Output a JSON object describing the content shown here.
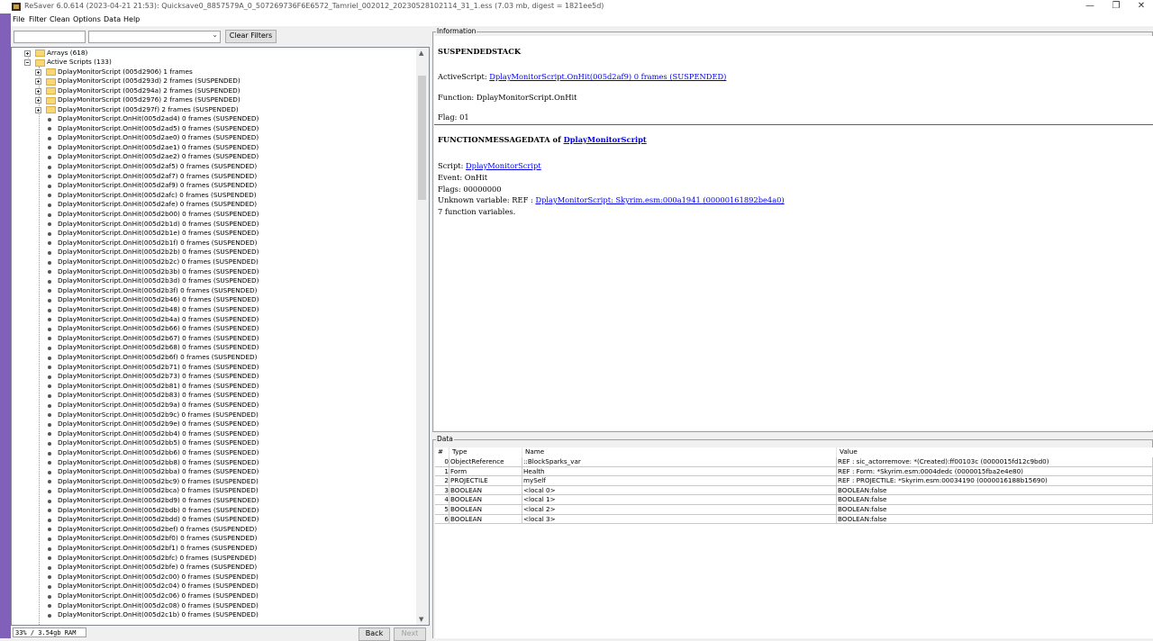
{
  "window": {
    "title": "ReSaver 6.0.614 (2023-04-21 21:53): Quicksave0_8857579A_0_507269736F6E6572_Tamriel_002012_20230528102114_31_1.ess (7.03 mb, digest = 1821ee5d)",
    "minimize_glyph": "—",
    "maximize_glyph": "❐",
    "close_glyph": "✕"
  },
  "menu": [
    "File",
    "Filter",
    "Clean",
    "Options",
    "Data",
    "Help"
  ],
  "filter": {
    "text_value": "",
    "combo_value": "",
    "clear_label": "Clear Filters"
  },
  "tree": {
    "arrays_label": "Arrays (618)",
    "active_scripts_label": "Active Scripts (133)",
    "folders": [
      "DplayMonitorScript (005d2906) 1 frames",
      "DplayMonitorScript (005d293d) 2 frames (SUSPENDED)",
      "DplayMonitorScript (005d294a) 2 frames (SUSPENDED)",
      "DplayMonitorScript (005d2976) 2 frames (SUSPENDED)",
      "DplayMonitorScript (005d297f) 2 frames (SUSPENDED)"
    ],
    "entries": [
      "DplayMonitorScript.OnHit(005d2ad4) 0 frames (SUSPENDED)",
      "DplayMonitorScript.OnHit(005d2ad5) 0 frames (SUSPENDED)",
      "DplayMonitorScript.OnHit(005d2ae0) 0 frames (SUSPENDED)",
      "DplayMonitorScript.OnHit(005d2ae1) 0 frames (SUSPENDED)",
      "DplayMonitorScript.OnHit(005d2ae2) 0 frames (SUSPENDED)",
      "DplayMonitorScript.OnHit(005d2af5) 0 frames (SUSPENDED)",
      "DplayMonitorScript.OnHit(005d2af7) 0 frames (SUSPENDED)",
      "DplayMonitorScript.OnHit(005d2af9) 0 frames (SUSPENDED)",
      "DplayMonitorScript.OnHit(005d2afc) 0 frames (SUSPENDED)",
      "DplayMonitorScript.OnHit(005d2afe) 0 frames (SUSPENDED)",
      "DplayMonitorScript.OnHit(005d2b00) 0 frames (SUSPENDED)",
      "DplayMonitorScript.OnHit(005d2b1d) 0 frames (SUSPENDED)",
      "DplayMonitorScript.OnHit(005d2b1e) 0 frames (SUSPENDED)",
      "DplayMonitorScript.OnHit(005d2b1f) 0 frames (SUSPENDED)",
      "DplayMonitorScript.OnHit(005d2b2b) 0 frames (SUSPENDED)",
      "DplayMonitorScript.OnHit(005d2b2c) 0 frames (SUSPENDED)",
      "DplayMonitorScript.OnHit(005d2b3b) 0 frames (SUSPENDED)",
      "DplayMonitorScript.OnHit(005d2b3d) 0 frames (SUSPENDED)",
      "DplayMonitorScript.OnHit(005d2b3f) 0 frames (SUSPENDED)",
      "DplayMonitorScript.OnHit(005d2b46) 0 frames (SUSPENDED)",
      "DplayMonitorScript.OnHit(005d2b48) 0 frames (SUSPENDED)",
      "DplayMonitorScript.OnHit(005d2b4a) 0 frames (SUSPENDED)",
      "DplayMonitorScript.OnHit(005d2b66) 0 frames (SUSPENDED)",
      "DplayMonitorScript.OnHit(005d2b67) 0 frames (SUSPENDED)",
      "DplayMonitorScript.OnHit(005d2b68) 0 frames (SUSPENDED)",
      "DplayMonitorScript.OnHit(005d2b6f) 0 frames (SUSPENDED)",
      "DplayMonitorScript.OnHit(005d2b71) 0 frames (SUSPENDED)",
      "DplayMonitorScript.OnHit(005d2b73) 0 frames (SUSPENDED)",
      "DplayMonitorScript.OnHit(005d2b81) 0 frames (SUSPENDED)",
      "DplayMonitorScript.OnHit(005d2b83) 0 frames (SUSPENDED)",
      "DplayMonitorScript.OnHit(005d2b9a) 0 frames (SUSPENDED)",
      "DplayMonitorScript.OnHit(005d2b9c) 0 frames (SUSPENDED)",
      "DplayMonitorScript.OnHit(005d2b9e) 0 frames (SUSPENDED)",
      "DplayMonitorScript.OnHit(005d2bb4) 0 frames (SUSPENDED)",
      "DplayMonitorScript.OnHit(005d2bb5) 0 frames (SUSPENDED)",
      "DplayMonitorScript.OnHit(005d2bb6) 0 frames (SUSPENDED)",
      "DplayMonitorScript.OnHit(005d2bb8) 0 frames (SUSPENDED)",
      "DplayMonitorScript.OnHit(005d2bba) 0 frames (SUSPENDED)",
      "DplayMonitorScript.OnHit(005d2bc9) 0 frames (SUSPENDED)",
      "DplayMonitorScript.OnHit(005d2bca) 0 frames (SUSPENDED)",
      "DplayMonitorScript.OnHit(005d2bd9) 0 frames (SUSPENDED)",
      "DplayMonitorScript.OnHit(005d2bdb) 0 frames (SUSPENDED)",
      "DplayMonitorScript.OnHit(005d2bdd) 0 frames (SUSPENDED)",
      "DplayMonitorScript.OnHit(005d2bef) 0 frames (SUSPENDED)",
      "DplayMonitorScript.OnHit(005d2bf0) 0 frames (SUSPENDED)",
      "DplayMonitorScript.OnHit(005d2bf1) 0 frames (SUSPENDED)",
      "DplayMonitorScript.OnHit(005d2bfc) 0 frames (SUSPENDED)",
      "DplayMonitorScript.OnHit(005d2bfe) 0 frames (SUSPENDED)",
      "DplayMonitorScript.OnHit(005d2c00) 0 frames (SUSPENDED)",
      "DplayMonitorScript.OnHit(005d2c04) 0 frames (SUSPENDED)",
      "DplayMonitorScript.OnHit(005d2c06) 0 frames (SUSPENDED)",
      "DplayMonitorScript.OnHit(005d2c08) 0 frames (SUSPENDED)",
      "DplayMonitorScript.OnHit(005d2c1b) 0 frames (SUSPENDED)"
    ]
  },
  "status": {
    "memory": "33% / 3.54gb RAM",
    "back_label": "Back",
    "next_label": "Next"
  },
  "info": {
    "group_label": "Information",
    "heading": "SUSPENDEDSTACK",
    "active_script_prefix": "ActiveScript: ",
    "active_script_link": "DplayMonitorScript.OnHit(005d2af9) 0 frames (SUSPENDED)",
    "function_line": "Function: DplayMonitorScript.OnHit",
    "flag_line": "Flag: 01",
    "fmd_heading": "FUNCTIONMESSAGEDATA of ",
    "fmd_link": "DplayMonitorScript",
    "script_prefix": "Script: ",
    "script_link": "DplayMonitorScript",
    "event_line": "Event: OnHit",
    "flags_line": "Flags: 00000000",
    "unknown_prefix": "Unknown variable: REF : ",
    "unknown_link": "DplayMonitorScript: Skyrim.esm:000a1941 (00000161892be4a0)",
    "fn_vars_line": "7 function variables."
  },
  "data_panel": {
    "group_label": "Data",
    "headers": [
      "#",
      "Type",
      "Name",
      "Value"
    ],
    "rows": [
      [
        "0",
        "ObjectReference",
        "::BlockSparks_var",
        "REF : sic_actorremove: *(Created):ff00103c (0000015fd12c9bd0)"
      ],
      [
        "1",
        "Form",
        "Health",
        "REF : Form: *Skyrim.esm:0004dedc (0000015fba2e4e80)"
      ],
      [
        "2",
        "PROJECTILE",
        "mySelf",
        "REF : PROJECTILE: *Skyrim.esm:00034190 (0000016188b15690)"
      ],
      [
        "3",
        "BOOLEAN",
        "<local 0>",
        "BOOLEAN:false"
      ],
      [
        "4",
        "BOOLEAN",
        "<local 1>",
        "BOOLEAN:false"
      ],
      [
        "5",
        "BOOLEAN",
        "<local 2>",
        "BOOLEAN:false"
      ],
      [
        "6",
        "BOOLEAN",
        "<local 3>",
        "BOOLEAN:false"
      ]
    ]
  },
  "colors": {
    "accent_strip": "#8060b8",
    "link": "#0000ee",
    "folder": "#f8d775"
  }
}
